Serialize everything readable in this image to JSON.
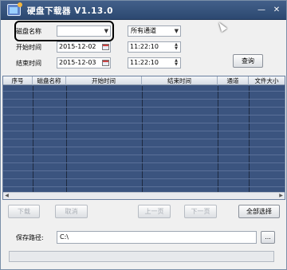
{
  "window": {
    "title": "硬盘下载器 V1.13.0",
    "minimize_glyph": "—",
    "close_glyph": "✕"
  },
  "filters": {
    "disk_name_label": "磁盘名称",
    "disk_name_value": "",
    "channel_value": "所有通道",
    "start_label": "开始时间",
    "start_date": "2015-12-02",
    "start_time": "11:22:10",
    "end_label": "结束时间",
    "end_date": "2015-12-03",
    "end_time": "11:22:10",
    "query_button": "查询"
  },
  "table": {
    "columns": [
      "序号",
      "磁盘名称",
      "开始时间",
      "结束时间",
      "通道",
      "文件大小"
    ],
    "rows": []
  },
  "actions": {
    "download": "下载",
    "cancel": "取消",
    "prev_page": "上一页",
    "next_page": "下一页",
    "select_all": "全部选择"
  },
  "save": {
    "label": "保存路径:",
    "path": "C:\\",
    "browse": "..."
  },
  "progress": {
    "value": 0
  }
}
